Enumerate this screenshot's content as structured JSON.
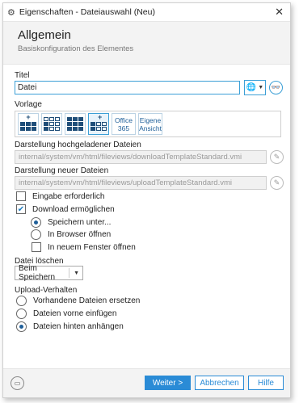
{
  "window": {
    "title": "Eigenschaften - Dateiauswahl (Neu)",
    "close_glyph": "✕"
  },
  "header": {
    "title": "Allgemein",
    "subtitle": "Basiskonfiguration des Elementes"
  },
  "form": {
    "title_label": "Titel",
    "title_value": "Datei",
    "template_label": "Vorlage",
    "templates": [
      {
        "name": "grid-upload",
        "selected": false
      },
      {
        "name": "list-grid",
        "selected": false
      },
      {
        "name": "grid-move",
        "selected": false
      },
      {
        "name": "list-upload",
        "selected": true
      },
      {
        "name": "office365",
        "text1": "Office",
        "text2": "365"
      },
      {
        "name": "eigene-ansicht",
        "text1": "Eigene",
        "text2": "Ansicht"
      }
    ],
    "uploaded_label": "Darstellung hochgeladener Dateien",
    "uploaded_path": "internal/system/vm/html/fileviews/downloadTemplateStandard.vmi",
    "new_label": "Darstellung neuer Dateien",
    "new_path": "internal/system/vm/html/fileviews/uploadTemplateStandard.vmi",
    "checkbox_required": {
      "label": "Eingabe erforderlich",
      "checked": false
    },
    "checkbox_download": {
      "label": "Download ermöglichen",
      "checked": true
    },
    "download_options": [
      {
        "label": "Speichern unter...",
        "selected": true
      },
      {
        "label": "In Browser öffnen",
        "selected": false
      }
    ],
    "checkbox_new_window": {
      "label": "In neuem Fenster öffnen",
      "checked": false
    },
    "delete_label": "Datei löschen",
    "delete_select": "Beim Speichern",
    "upload_label": "Upload-Verhalten",
    "upload_options": [
      {
        "label": "Vorhandene Dateien ersetzen",
        "selected": false
      },
      {
        "label": "Dateien vorne einfügen",
        "selected": false
      },
      {
        "label": "Dateien hinten anhängen",
        "selected": true
      }
    ]
  },
  "footer": {
    "next": "Weiter >",
    "cancel": "Abbrechen",
    "help": "Hilfe"
  },
  "colors": {
    "accent": "#2a8bd6",
    "icon_navy": "#1f4e79"
  }
}
